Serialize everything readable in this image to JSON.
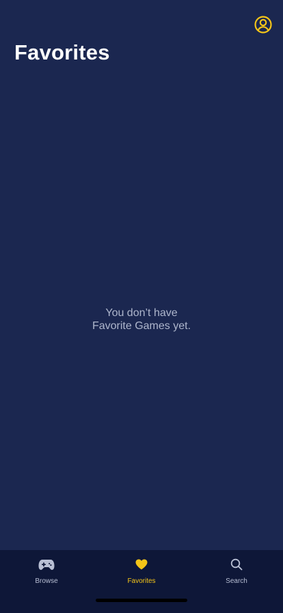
{
  "header": {
    "title": "Favorites",
    "profile_icon": "person-circle-icon"
  },
  "empty_state": {
    "line1": "You don’t have",
    "line2": "Favorite Games yet."
  },
  "tab_bar": {
    "tabs": [
      {
        "label": "Browse",
        "icon": "gamepad-icon",
        "active": false
      },
      {
        "label": "Favorites",
        "icon": "heart-icon",
        "active": true
      },
      {
        "label": "Search",
        "icon": "search-icon",
        "active": false
      }
    ]
  },
  "colors": {
    "background": "#1b2750",
    "tab_bar": "#0e1738",
    "accent": "#f5c518",
    "inactive": "#b8bfd4",
    "title": "#ffffff",
    "empty_text": "#aeb6cc"
  }
}
